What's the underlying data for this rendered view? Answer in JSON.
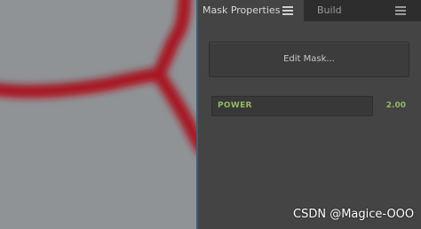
{
  "colors": {
    "viewport_background": "#8f9396",
    "stroke_red": "#a81824",
    "panel_background": "#444444",
    "tabbar_background": "#2d2d2d",
    "accent_green": "#95b862"
  },
  "tabs": [
    {
      "label": "Mask Properties",
      "active": true,
      "icon": "hamburger-menu-icon"
    },
    {
      "label": "Build",
      "active": false,
      "icon": "hamburger-menu-icon"
    }
  ],
  "mask_properties": {
    "edit_button_label": "Edit Mask...",
    "power": {
      "label": "POWER",
      "value": "2.00"
    }
  },
  "watermark": "CSDN @Magice-OOO"
}
